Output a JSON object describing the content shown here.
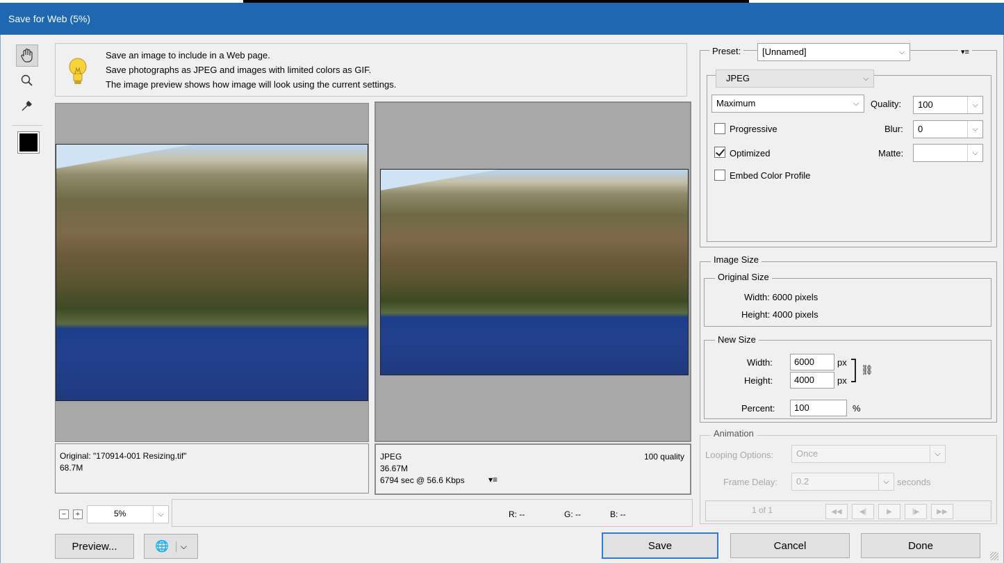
{
  "window": {
    "title": "Save for Web (5%)"
  },
  "info": {
    "line1": "Save an image to include in a Web page.",
    "line2": "Save photographs as JPEG and images with limited colors as GIF.",
    "line3": "The image preview shows how image will look using the current settings."
  },
  "original": {
    "caption": "Original: \"170914-001 Resizing.tif\"",
    "size": "68.7M"
  },
  "optimized": {
    "format": "JPEG",
    "quality": "100 quality",
    "size": "36.67M",
    "download": "6794 sec @ 56.6 Kbps"
  },
  "zoom": {
    "value": "5%"
  },
  "status": {
    "r": "R: --",
    "g": "G: --",
    "b": "B: --"
  },
  "preset": {
    "label": "Preset:",
    "value": "[Unnamed]",
    "format": "JPEG",
    "quality_preset": "Maximum",
    "quality_label": "Quality:",
    "quality_value": "100",
    "blur_label": "Blur:",
    "blur_value": "0",
    "matte_label": "Matte:",
    "matte_value": "",
    "progressive": "Progressive",
    "progressive_checked": false,
    "optimized": "Optimized",
    "optimized_checked": true,
    "embed": "Embed Color Profile",
    "embed_checked": false
  },
  "image_size": {
    "title": "Image Size",
    "original_title": "Original Size",
    "width_text": "Width:  6000 pixels",
    "height_text": "Height:  4000 pixels",
    "new_title": "New Size",
    "width_label": "Width:",
    "width_value": "6000",
    "unit": "px",
    "height_label": "Height:",
    "height_value": "4000",
    "percent_label": "Percent:",
    "percent_value": "100",
    "percent_unit": "%"
  },
  "animation": {
    "title": "Animation",
    "looping_label": "Looping Options:",
    "looping_value": "Once",
    "delay_label": "Frame Delay:",
    "delay_value": "0.2",
    "delay_unit": "seconds",
    "frame_counter": "1 of 1"
  },
  "buttons": {
    "preview": "Preview...",
    "save": "Save",
    "cancel": "Cancel",
    "done": "Done"
  }
}
